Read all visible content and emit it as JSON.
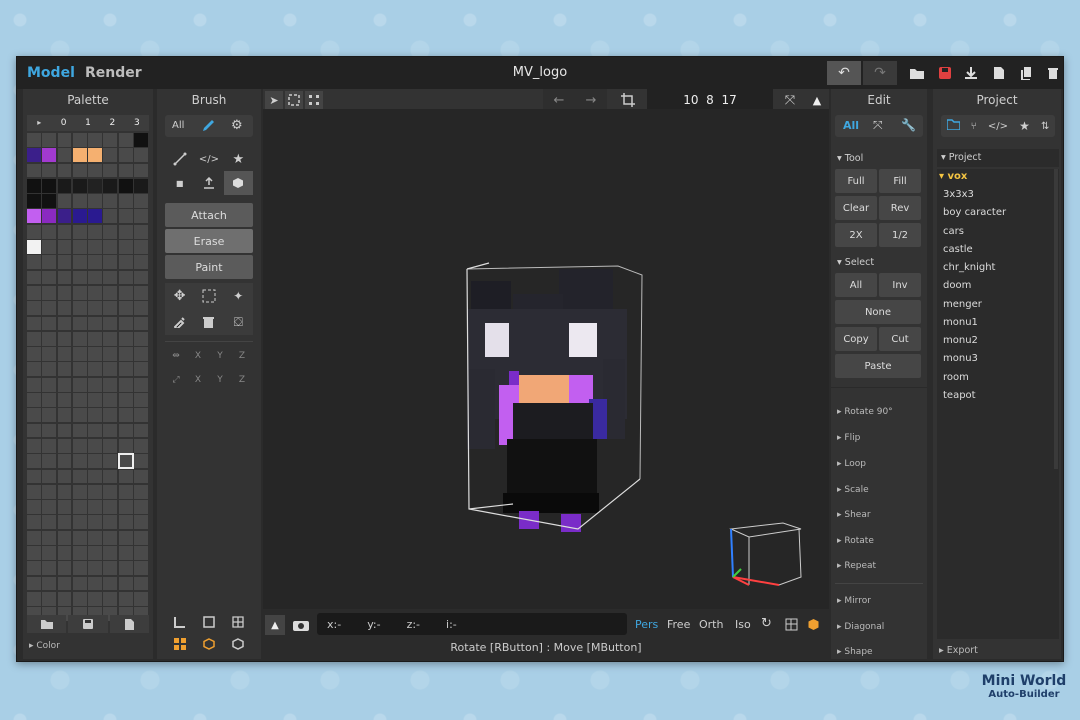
{
  "topbar": {
    "tab_model": "Model",
    "tab_render": "Render",
    "doc_title": "MV_logo"
  },
  "palette": {
    "title": "Palette",
    "tabs": [
      "▸",
      "0",
      "1",
      "2",
      "3"
    ],
    "footer": "Color"
  },
  "brush": {
    "title": "Brush",
    "all": "All",
    "attach": "Attach",
    "erase": "Erase",
    "paint": "Paint",
    "axes": [
      "X",
      "Y",
      "Z"
    ]
  },
  "viewport": {
    "size": "10  8  17",
    "coords": {
      "x": "x:-",
      "y": "y:-",
      "z": "z:-",
      "i": "i:-"
    },
    "views": [
      "Pers",
      "Free",
      "Orth",
      "Iso"
    ],
    "status": "Rotate [RButton] : Move [MButton]"
  },
  "edit": {
    "title": "Edit",
    "all": "All",
    "tool": "Tool",
    "tool_buttons": [
      "Full",
      "Fill",
      "Clear",
      "Rev",
      "2X",
      "1/2"
    ],
    "select": "Select",
    "select_buttons": [
      "All",
      "Inv",
      "None",
      "Copy",
      "Cut",
      "Paste"
    ],
    "actions": [
      "Rotate 90°",
      "Flip",
      "Loop",
      "Scale",
      "Shear",
      "Rotate",
      "Repeat",
      "Mirror",
      "Diagonal",
      "Shape"
    ]
  },
  "project": {
    "title": "Project",
    "section": "Project",
    "items": [
      "vox",
      "3x3x3",
      "boy caracter",
      "cars",
      "castle",
      "chr_knight",
      "doom",
      "menger",
      "monu1",
      "monu2",
      "monu3",
      "room",
      "teapot"
    ],
    "export": "Export"
  },
  "watermark": {
    "line1": "Mini World",
    "line2": "Auto-Builder"
  },
  "colors": {
    "accent": "#3fa7e0",
    "selected_item": "#f5c542",
    "save_icon": "#e04040"
  }
}
